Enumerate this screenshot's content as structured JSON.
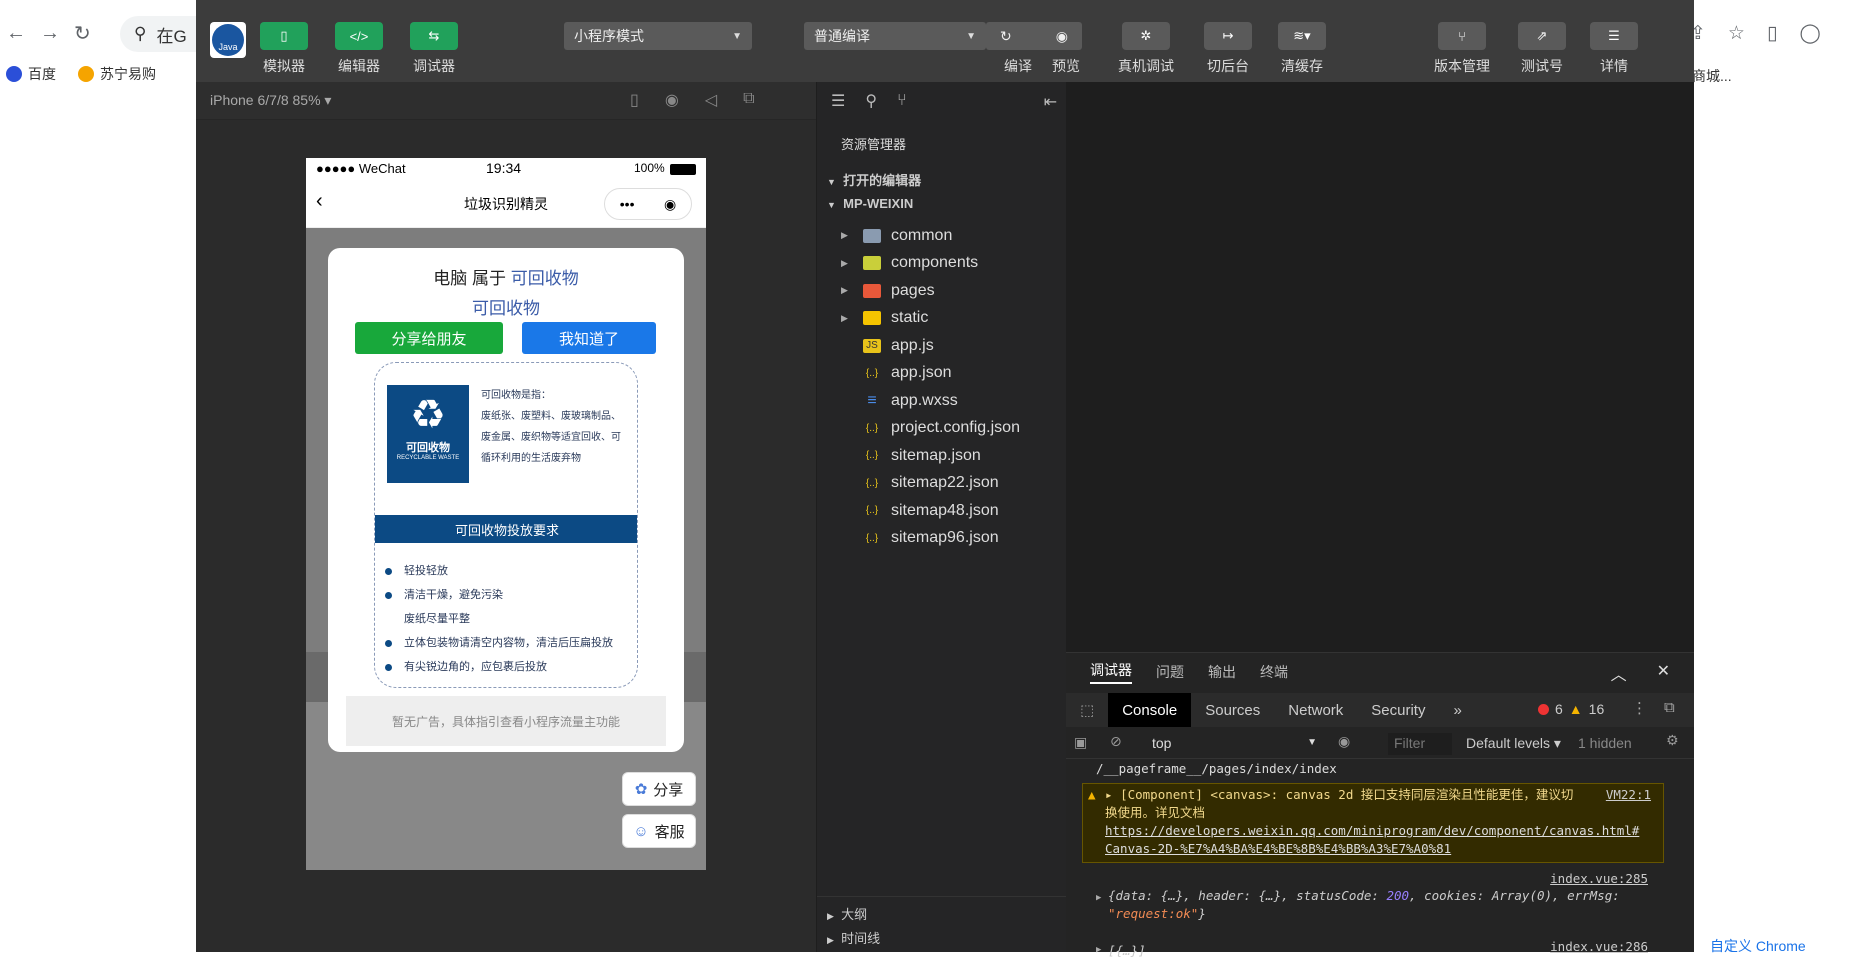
{
  "browser": {
    "omnibox_text": "在G",
    "bookmarks": [
      {
        "label": "百度",
        "color": "#2b4fd8"
      },
      {
        "label": "苏宁易购",
        "color": "#f5a400"
      }
    ],
    "right_bookmark": "商城...",
    "customize_label": "自定义 Chrome"
  },
  "toolbar": {
    "app_icon_label": "Java",
    "simulator": "模拟器",
    "editor": "编辑器",
    "debugger": "调试器",
    "mode_select": "小程序模式",
    "compile_select": "普通编译",
    "compile": "编译",
    "preview": "预览",
    "real_debug": "真机调试",
    "backstage": "切后台",
    "clear_cache": "清缓存",
    "version": "版本管理",
    "test_account": "测试号",
    "details": "详情"
  },
  "simulator": {
    "device": "iPhone 6/7/8 85%",
    "status": {
      "carrier": "●●●●● WeChat",
      "time": "19:34",
      "battery": "100%"
    },
    "nav_title": "垃圾识别精灵",
    "modal": {
      "item": "电脑",
      "belongs": "属于",
      "category": "可回收物",
      "category_line2": "可回收物",
      "share_btn": "分享给朋友",
      "ok_btn": "我知道了",
      "card_icon_cn": "可回收物",
      "card_icon_en": "RECYCLABLE WASTE",
      "desc_title": "可回收物是指：",
      "desc_body": "废纸张、废塑料、废玻璃制品、废金属、废织物等适宜回收、可循环利用的生活废弃物",
      "band": "可回收物投放要求",
      "rules": [
        "轻投轻放",
        "清洁干燥，避免污染",
        "废纸尽量平整",
        "立体包装物请清空内容物，清洁后压扁投放",
        "有尖锐边角的，应包裹后投放"
      ],
      "ad": "暂无广告，具体指引查看小程序流量主功能"
    },
    "share_float": "分享",
    "service_float": "客服"
  },
  "explorer": {
    "title": "资源管理器",
    "open_editors": "打开的编辑器",
    "project": "MP-WEIXIN",
    "files": [
      {
        "name": "common",
        "type": "folder",
        "color": "#8a9bb0"
      },
      {
        "name": "components",
        "type": "folder",
        "color": "#c9cf3a"
      },
      {
        "name": "pages",
        "type": "folder",
        "color": "#e8583a"
      },
      {
        "name": "static",
        "type": "folder",
        "color": "#f5c400"
      },
      {
        "name": "app.js",
        "type": "js",
        "color": "#e8c31a"
      },
      {
        "name": "app.json",
        "type": "json",
        "color": "#e8c31a"
      },
      {
        "name": "app.wxss",
        "type": "wxss",
        "color": "#4a8be8"
      },
      {
        "name": "project.config.json",
        "type": "json",
        "color": "#e8c31a"
      },
      {
        "name": "sitemap.json",
        "type": "json",
        "color": "#e8c31a"
      },
      {
        "name": "sitemap22.json",
        "type": "json",
        "color": "#e8c31a"
      },
      {
        "name": "sitemap48.json",
        "type": "json",
        "color": "#e8c31a"
      },
      {
        "name": "sitemap96.json",
        "type": "json",
        "color": "#e8c31a"
      }
    ],
    "outline": "大纲",
    "timeline": "时间线"
  },
  "debugger": {
    "tabs": [
      "调试器",
      "问题",
      "输出",
      "终端"
    ],
    "devtools_tabs": [
      "Console",
      "Sources",
      "Network",
      "Security"
    ],
    "errors": "6",
    "warnings": "16",
    "context": "top",
    "filter_placeholder": "Filter",
    "levels": "Default levels",
    "hidden": "1 hidden",
    "console": {
      "path": "/__pageframe__/pages/index/index",
      "warn_text": "[Component] <canvas>: canvas 2d 接口支持同层渲染且性能更佳，建议切换使用。详见文档",
      "warn_src": "VM22:1",
      "warn_link": "https://developers.weixin.qq.com/miniprogram/dev/component/canvas.html#Canvas-2D-%E7%A4%BA%E4%BE%8B%E4%BB%A3%E7%A0%81",
      "log1_src": "index.vue:285",
      "log1_a": "{data: {…}, header: {…}, statusCode: ",
      "log1_num": "200",
      "log1_b": ", cookies: Array(0), errMsg: ",
      "log1_str": "\"request:ok\"",
      "log1_c": "}",
      "log2_src": "index.vue:286",
      "log2": "[{…}]"
    }
  }
}
